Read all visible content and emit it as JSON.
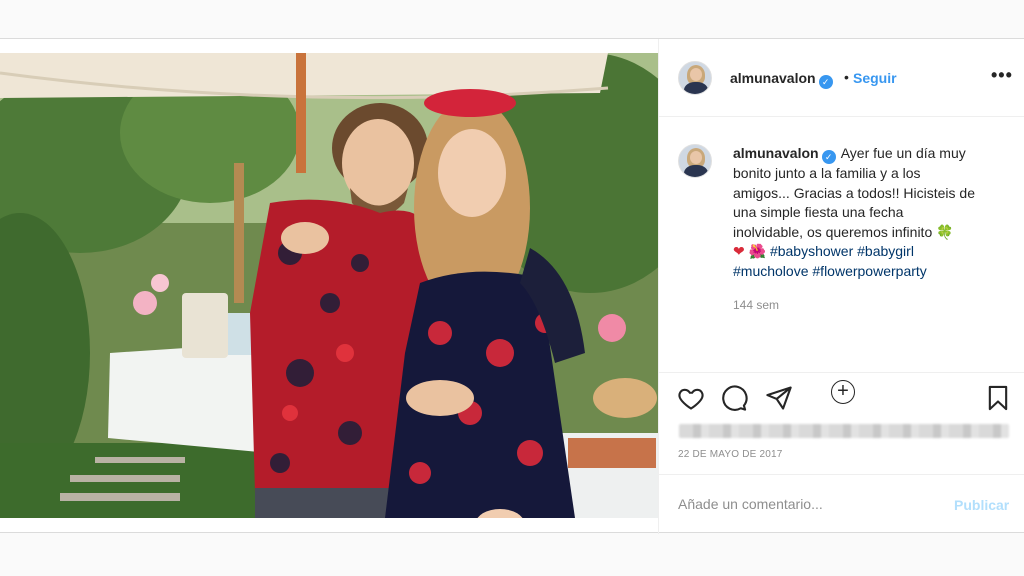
{
  "post": {
    "username": "almunavalon",
    "verified": true,
    "separator": "•",
    "follow_label": "Seguir",
    "more_label": "•••",
    "caption": {
      "line1": "Ayer fue un día muy",
      "line2": "bonito junto a la familia y a los",
      "line3": "amigos... Gracias a todos!! Hicisteis de",
      "line4": "una simple fiesta una fecha",
      "line5": "inolvidable, os queremos infinito",
      "emoji_clover": "🍀",
      "emoji_heart": "❤",
      "emoji_flower": "🌺",
      "hashtags": [
        "#babyshower",
        "#babygirl",
        "#mucholove",
        "#flowerpowerparty"
      ]
    },
    "time_ago": "144 sem",
    "load_more": "+",
    "date": "22 DE MAYO DE 2017",
    "comment": {
      "placeholder": "Añade un comentario...",
      "publish_label": "Publicar"
    }
  },
  "icons": {
    "like": "heart-icon",
    "comment": "comment-icon",
    "share": "share-icon",
    "save": "bookmark-icon",
    "verified": "verified-badge-icon",
    "more": "more-options-icon",
    "load_more": "plus-circle-icon"
  },
  "colors": {
    "link_blue": "#3897f0",
    "hashtag": "#003569",
    "publish_disabled": "#b2dffc",
    "muted": "#8e8e8e"
  }
}
